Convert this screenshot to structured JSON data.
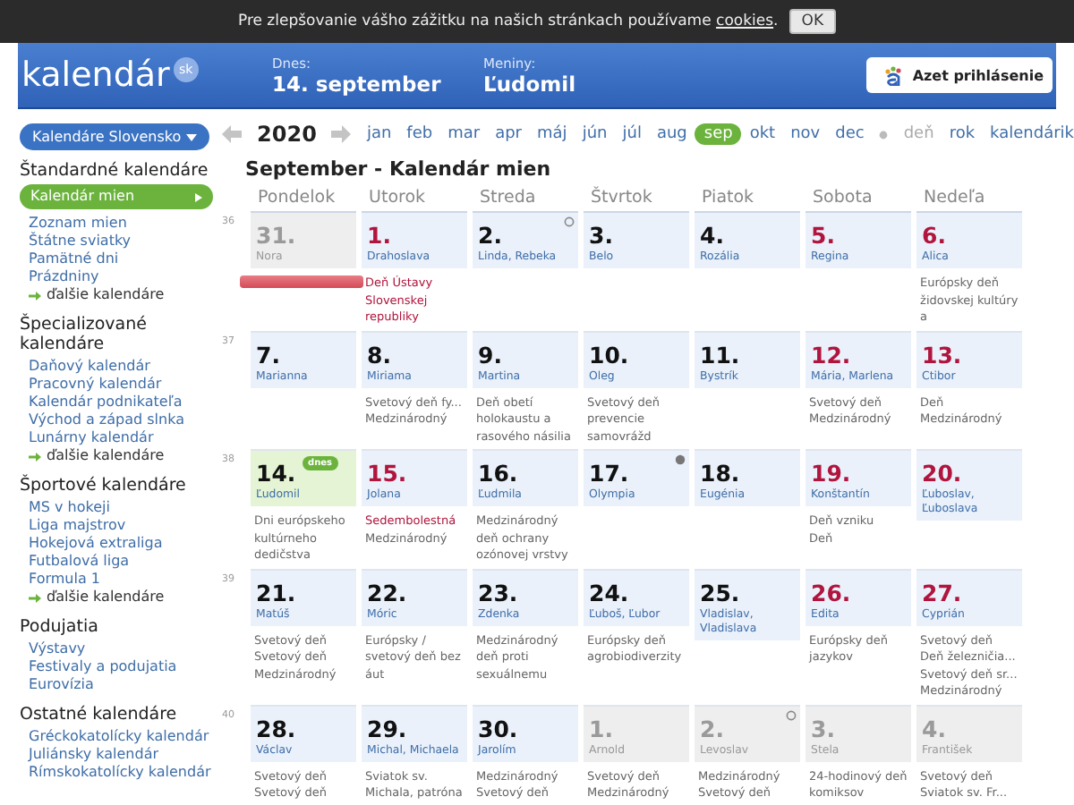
{
  "cookie_bar": {
    "text": "Pre zlepšovanie vášho zážitku na našich stránkach používame",
    "link": "cookies",
    "after": ".",
    "button": "OK"
  },
  "header": {
    "logo": "kalendár",
    "logo_badge": "sk",
    "today_label": "Dnes:",
    "today_value": "14. september",
    "nameday_label": "Meniny:",
    "nameday_value": "Ľudomil",
    "login_button": "Azet prihlásenie"
  },
  "sidebar": {
    "dropdown": "Kalendáre Slovensko",
    "sections": [
      {
        "title": "Štandardné kalendáre",
        "items": [
          {
            "label": "Kalendár mien",
            "kind": "link",
            "selected": true
          },
          {
            "label": "Zoznam mien",
            "kind": "link",
            "selected": false
          },
          {
            "label": "Štátne sviatky",
            "kind": "link",
            "selected": false
          },
          {
            "label": "Pamätné dni",
            "kind": "link",
            "selected": false
          },
          {
            "label": "Prázdniny",
            "kind": "link",
            "selected": false
          },
          {
            "label": "ďalšie kalendáre",
            "kind": "more"
          }
        ]
      },
      {
        "title": "Špecializované kalendáre",
        "items": [
          {
            "label": "Daňový kalendár",
            "kind": "link",
            "selected": false
          },
          {
            "label": "Pracovný kalendár",
            "kind": "link",
            "selected": false
          },
          {
            "label": "Kalendár podnikateľa",
            "kind": "link",
            "selected": false
          },
          {
            "label": "Východ a západ slnka",
            "kind": "link",
            "selected": false
          },
          {
            "label": "Lunárny kalendár",
            "kind": "link",
            "selected": false
          },
          {
            "label": "ďalšie kalendáre",
            "kind": "more"
          }
        ]
      },
      {
        "title": "Športové kalendáre",
        "items": [
          {
            "label": "MS v hokeji",
            "kind": "link",
            "selected": false
          },
          {
            "label": "Liga majstrov",
            "kind": "link",
            "selected": false
          },
          {
            "label": "Hokejová extraliga",
            "kind": "link",
            "selected": false
          },
          {
            "label": "Futbalová liga",
            "kind": "link",
            "selected": false
          },
          {
            "label": "Formula 1",
            "kind": "link",
            "selected": false
          },
          {
            "label": "ďalšie kalendáre",
            "kind": "more"
          }
        ]
      },
      {
        "title": "Podujatia",
        "items": [
          {
            "label": "Výstavy",
            "kind": "link",
            "selected": false
          },
          {
            "label": "Festivaly a podujatia",
            "kind": "link",
            "selected": false
          },
          {
            "label": "Eurovízia",
            "kind": "link",
            "selected": false
          }
        ]
      },
      {
        "title": "Ostatné kalendáre",
        "items": [
          {
            "label": "Gréckokatolícky kalendár",
            "kind": "link",
            "selected": false
          },
          {
            "label": "Juliánsky kalendár",
            "kind": "link",
            "selected": false
          },
          {
            "label": "Rímskokatolícky kalendár",
            "kind": "link",
            "selected": false
          }
        ]
      }
    ]
  },
  "nav": {
    "year": "2020",
    "months": [
      {
        "label": "jan",
        "selected": false
      },
      {
        "label": "feb",
        "selected": false
      },
      {
        "label": "mar",
        "selected": false
      },
      {
        "label": "apr",
        "selected": false
      },
      {
        "label": "máj",
        "selected": false
      },
      {
        "label": "jún",
        "selected": false
      },
      {
        "label": "júl",
        "selected": false
      },
      {
        "label": "aug",
        "selected": false
      },
      {
        "label": "sep",
        "selected": true
      },
      {
        "label": "okt",
        "selected": false
      },
      {
        "label": "nov",
        "selected": false
      },
      {
        "label": "dec",
        "selected": false
      }
    ],
    "views": [
      {
        "label": "deň",
        "disabled": true
      },
      {
        "label": "rok",
        "disabled": false
      },
      {
        "label": "kalendárik",
        "disabled": false
      }
    ]
  },
  "calendar": {
    "title": "September - Kalendár mien",
    "weekdays": [
      "Pondelok",
      "Utorok",
      "Streda",
      "Štvrtok",
      "Piatok",
      "Sobota",
      "Nedeľa"
    ],
    "weeks": [
      {
        "number": "36",
        "days": [
          {
            "day": "31.",
            "name": "Nora",
            "kind": "other",
            "bar": true
          },
          {
            "day": "1.",
            "name": "Drahoslava",
            "kind": "current",
            "holiday": true,
            "events": [
              {
                "text": "Deň Ústavy Slovenskej republiky",
                "highlighted": true
              }
            ]
          },
          {
            "day": "2.",
            "name": "Linda, Rebeka",
            "kind": "current",
            "holiday": false,
            "moon": {
              "kind": "full"
            }
          },
          {
            "day": "3.",
            "name": "Belo",
            "kind": "current",
            "holiday": false
          },
          {
            "day": "4.",
            "name": "Rozália",
            "kind": "current",
            "holiday": false
          },
          {
            "day": "5.",
            "name": "Regina",
            "kind": "current",
            "holiday": true
          },
          {
            "day": "6.",
            "name": "Alica",
            "kind": "current",
            "holiday": true,
            "events": [
              {
                "text": "Európsky deň židovskej kultúry a",
                "highlighted": false
              }
            ]
          }
        ]
      },
      {
        "number": "37",
        "days": [
          {
            "day": "7.",
            "name": "Marianna",
            "kind": "current",
            "holiday": false
          },
          {
            "day": "8.",
            "name": "Miriama",
            "kind": "current",
            "holiday": false,
            "events": [
              {
                "text": "Svetový deň fy...",
                "highlighted": false
              },
              {
                "text": "Medzinárodný",
                "highlighted": false
              }
            ]
          },
          {
            "day": "9.",
            "name": "Martina",
            "kind": "current",
            "holiday": false,
            "events": [
              {
                "text": "Deň obetí holokaustu a rasového násilia",
                "highlighted": false
              }
            ]
          },
          {
            "day": "10.",
            "name": "Oleg",
            "kind": "current",
            "holiday": false,
            "events": [
              {
                "text": "Svetový deň prevencie samovrážd",
                "highlighted": false
              }
            ]
          },
          {
            "day": "11.",
            "name": "Bystrík",
            "kind": "current",
            "holiday": false
          },
          {
            "day": "12.",
            "name": "Mária, Marlena",
            "kind": "current",
            "holiday": true,
            "events": [
              {
                "text": "Svetový deň",
                "highlighted": false
              },
              {
                "text": "Medzinárodný",
                "highlighted": false
              }
            ]
          },
          {
            "day": "13.",
            "name": "Ctibor",
            "kind": "current",
            "holiday": true,
            "events": [
              {
                "text": "Deň",
                "highlighted": false
              },
              {
                "text": "Medzinárodný",
                "highlighted": false
              }
            ]
          }
        ]
      },
      {
        "number": "38",
        "days": [
          {
            "day": "14.",
            "name": "Ľudomil",
            "kind": "today",
            "holiday": false,
            "badge": "dnes",
            "events": [
              {
                "text": "Dni európskeho kultúrneho dedičstva",
                "highlighted": false
              }
            ]
          },
          {
            "day": "15.",
            "name": "Jolana",
            "kind": "current",
            "holiday": true,
            "events": [
              {
                "text": "Sedembolestná",
                "highlighted": true
              },
              {
                "text": "Medzinárodný",
                "highlighted": false
              }
            ]
          },
          {
            "day": "16.",
            "name": "Ľudmila",
            "kind": "current",
            "holiday": false,
            "events": [
              {
                "text": "Medzinárodný deň ochrany ozónovej vrstvy",
                "highlighted": false
              }
            ]
          },
          {
            "day": "17.",
            "name": "Olympia",
            "kind": "current",
            "holiday": false,
            "moon": {
              "kind": "new"
            }
          },
          {
            "day": "18.",
            "name": "Eugénia",
            "kind": "current",
            "holiday": false
          },
          {
            "day": "19.",
            "name": "Konštantín",
            "kind": "current",
            "holiday": true,
            "events": [
              {
                "text": "Deň vzniku",
                "highlighted": false
              },
              {
                "text": "Deň",
                "highlighted": false
              }
            ]
          },
          {
            "day": "20.",
            "name": "Ľuboslav, Ľuboslava",
            "kind": "current",
            "holiday": true
          }
        ]
      },
      {
        "number": "39",
        "days": [
          {
            "day": "21.",
            "name": "Matúš",
            "kind": "current",
            "holiday": false,
            "events": [
              {
                "text": "Svetový deň",
                "highlighted": false
              },
              {
                "text": "Svetový deň",
                "highlighted": false
              },
              {
                "text": "Medzinárodný",
                "highlighted": false
              }
            ]
          },
          {
            "day": "22.",
            "name": "Móric",
            "kind": "current",
            "holiday": false,
            "events": [
              {
                "text": "Európsky / svetový deň bez áut",
                "highlighted": false
              }
            ]
          },
          {
            "day": "23.",
            "name": "Zdenka",
            "kind": "current",
            "holiday": false,
            "events": [
              {
                "text": "Medzinárodný deň proti sexuálnemu",
                "highlighted": false
              }
            ]
          },
          {
            "day": "24.",
            "name": "Ľuboš, Ľubor",
            "kind": "current",
            "holiday": false,
            "events": [
              {
                "text": "Európsky deň agrobiodiverzity",
                "highlighted": false
              }
            ]
          },
          {
            "day": "25.",
            "name": "Vladislav, Vladislava",
            "kind": "current",
            "holiday": false
          },
          {
            "day": "26.",
            "name": "Edita",
            "kind": "current",
            "holiday": true,
            "events": [
              {
                "text": "Európsky deň jazykov",
                "highlighted": false
              }
            ]
          },
          {
            "day": "27.",
            "name": "Cyprián",
            "kind": "current",
            "holiday": true,
            "events": [
              {
                "text": "Svetový deň",
                "highlighted": false
              },
              {
                "text": "Deň železničia...",
                "highlighted": false
              },
              {
                "text": "Svetový deň sr...",
                "highlighted": false
              },
              {
                "text": "Medzinárodný",
                "highlighted": false
              }
            ]
          }
        ]
      },
      {
        "number": "40",
        "days": [
          {
            "day": "28.",
            "name": "Václav",
            "kind": "current",
            "holiday": false,
            "events": [
              {
                "text": "Svetový deň",
                "highlighted": false
              },
              {
                "text": "Svetový deň",
                "highlighted": false
              }
            ]
          },
          {
            "day": "29.",
            "name": "Michal, Michaela",
            "kind": "current",
            "holiday": false,
            "events": [
              {
                "text": "Sviatok sv. Michala, patróna",
                "highlighted": false
              }
            ]
          },
          {
            "day": "30.",
            "name": "Jarolím",
            "kind": "current",
            "holiday": false,
            "events": [
              {
                "text": "Medzinárodný",
                "highlighted": false
              },
              {
                "text": "Svetový deň",
                "highlighted": false
              }
            ]
          },
          {
            "day": "1.",
            "name": "Arnold",
            "kind": "other",
            "events": [
              {
                "text": "Svetový deň",
                "highlighted": false
              },
              {
                "text": "Medzinárodný",
                "highlighted": false
              }
            ]
          },
          {
            "day": "2.",
            "name": "Levoslav",
            "kind": "other",
            "moon": {
              "kind": "full"
            },
            "events": [
              {
                "text": "Medzinárodný",
                "highlighted": false
              },
              {
                "text": "Svetový deň",
                "highlighted": false
              }
            ]
          },
          {
            "day": "3.",
            "name": "Stela",
            "kind": "other",
            "events": [
              {
                "text": "24-hodinový deň komiksov",
                "highlighted": false
              }
            ]
          },
          {
            "day": "4.",
            "name": "František",
            "kind": "other",
            "events": [
              {
                "text": "Svetový deň",
                "highlighted": false
              },
              {
                "text": "Sviatok sv. Fr...",
                "highlighted": false
              }
            ]
          }
        ]
      }
    ]
  }
}
